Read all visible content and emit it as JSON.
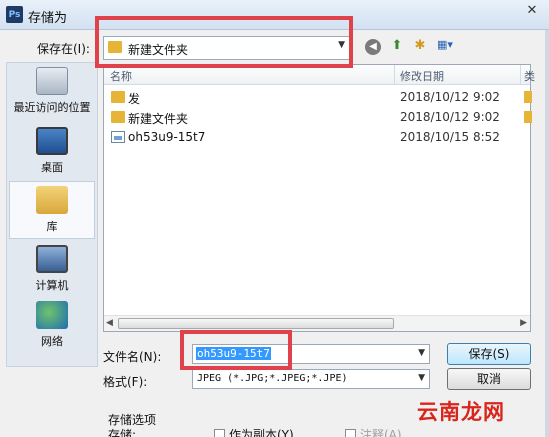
{
  "window": {
    "title": "存储为",
    "app_icon_text": "Ps",
    "close_glyph": "✕"
  },
  "save_in": {
    "label": "保存在(I):",
    "current_folder": "新建文件夹"
  },
  "toolbar": {
    "back_icon": "back-icon",
    "up_icon": "up-folder-icon",
    "new_folder_icon": "new-folder-icon",
    "view_menu_icon": "view-menu-icon"
  },
  "places": [
    {
      "label": "最近访问的位置",
      "icon": "recent-places-icon"
    },
    {
      "label": "桌面",
      "icon": "desktop-icon"
    },
    {
      "label": "库",
      "icon": "library-icon"
    },
    {
      "label": "计算机",
      "icon": "computer-icon"
    },
    {
      "label": "网络",
      "icon": "network-icon"
    }
  ],
  "file_list": {
    "columns": [
      "名称",
      "修改日期"
    ],
    "rows": [
      {
        "name": "发",
        "date": "2018/10/12 9:02",
        "type": "folder"
      },
      {
        "name": "新建文件夹",
        "date": "2018/10/12 9:02",
        "type": "folder"
      },
      {
        "name": "oh53u9-15t7",
        "date": "2018/10/15 8:52",
        "type": "image"
      }
    ]
  },
  "filename": {
    "label": "文件名(N):",
    "value": "oh53u9-15t7"
  },
  "format": {
    "label": "格式(F):",
    "selected": "JPEG (*.JPG;*.JPEG;*.JPE)"
  },
  "buttons": {
    "save": "保存(S)",
    "cancel": "取消"
  },
  "save_options": {
    "title": "存储选项",
    "store_label": "存储:",
    "as_copy": "作为副本(Y)",
    "notes": "注释(A)"
  },
  "watermark": "云南龙网",
  "colors": {
    "highlight": "#e0424b",
    "selection": "#3399ff",
    "watermark": "#d9261c"
  }
}
